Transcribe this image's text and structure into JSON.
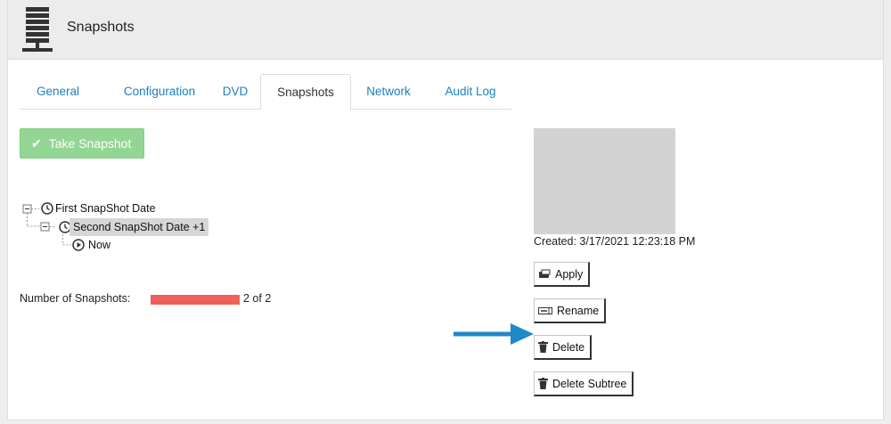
{
  "header": {
    "title": "Snapshots",
    "icon": "server-icon"
  },
  "tabs": [
    {
      "label": "General",
      "active": false
    },
    {
      "label": "Configuration",
      "active": false
    },
    {
      "label": "DVD",
      "active": false
    },
    {
      "label": "Snapshots",
      "active": true
    },
    {
      "label": "Network",
      "active": false
    },
    {
      "label": "Audit Log",
      "active": false
    }
  ],
  "toolbar": {
    "take_snapshot_label": "Take Snapshot"
  },
  "tree": [
    {
      "label": "First SnapShot Date",
      "icon": "history-icon",
      "selected": false
    },
    {
      "label": "Second SnapShot Date +1",
      "icon": "history-icon",
      "selected": true
    },
    {
      "label": "Now",
      "icon": "play-circle-icon",
      "selected": false
    }
  ],
  "summary": {
    "count_label": "Number of Snapshots:",
    "count_text": "2 of 2",
    "progress": 1.0,
    "progress_color": "#f0605a"
  },
  "details": {
    "created": "Created: 3/17/2021 12:23:18 PM"
  },
  "actions": {
    "apply": "Apply",
    "rename": "Rename",
    "delete": "Delete",
    "delete_subtree": "Delete Subtree"
  },
  "colors": {
    "accent": "#1a7fc1",
    "success": "#93d694",
    "annotation_arrow": "#1e88c9"
  }
}
